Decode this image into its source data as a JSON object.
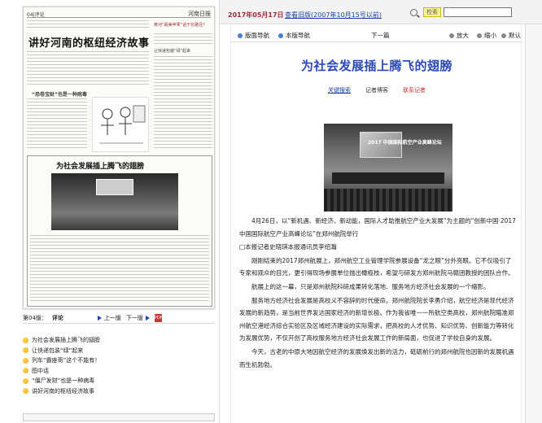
{
  "page": {
    "label": "04|评论",
    "page_label": "第04版：",
    "section": "评论",
    "prev": "上一版",
    "next": "下一版"
  },
  "paper": {
    "brand": "河南日报",
    "headline": "讲好河南的枢纽经济故事",
    "sub1": "“恐卷宝财”也是一种病毒",
    "sub2": "为社会发展插上腾飞的翅膀",
    "side1": "黄河“最美苹果”话于长路径？",
    "side2": "让快递包装“绿”起来"
  },
  "articles": [
    "为社会发展插上腾飞的翅膀",
    "让快递包装“绿”起来",
    "列车“霸座哥”这个不能有！",
    "图中话",
    "“僵尸发财”也是一种病毒",
    "讲好河南的枢纽经济故事"
  ],
  "top": {
    "date": "2017年05月17日",
    "old": "查看旧版(2007年10月15号以前)",
    "search_btn": "检索"
  },
  "toolbar": {
    "nav": "版面导航",
    "nav2": "本版导航",
    "next": "下一篇",
    "zoom_in": "放大",
    "zoom_out": "缩小",
    "default": "默认"
  },
  "article": {
    "title": "为社会发展插上腾飞的翅膀",
    "link1": "关键搜索",
    "link2": "记者博客",
    "link3": "联系记者",
    "photo_label": "2017 中国国际航空产业高峰论坛",
    "paragraphs": [
      "4月26日，以“新机遇、新经济、新动能，国际人才助推航空产业大发展”为主题的“创新中国·2017中国国际航空产业高峰论坛”在郑州航院举行",
      "□本报记者史晓琪本报通讯员李绍瀚",
      "刚刚结束的2017郑州航展上，郑州航空工业管理学院参展设备“龙之眼”分外亮眼。它不仅吸引了专家和观众的目光，更引得现场参展单位抛出橄榄枝，希望与研发方郑州航院马赣团教授的团队合作。",
      "航展上的这一幕，只是郑州航院科研成果转化落地、服务地方经济社会发展的一个缩影。",
      "服务地方经济社会发展是高校义不容辞的时代使命。郑州航院院长李勇介绍，航空经济是现代经济发展的新趋势，是当前世界发达国家经济的新增长极。作为我省唯一一所航空类高校，郑州航院瞄准郑州航空港经济综合实验区及区域经济建设的实际需求，把高校的人才优势、知识优势、创新能力等转化为发展优势，不仅开创了高校服务地方经济社会发展工作的新局面，也促进了学校自身的发展。",
      "今天，古老的中原大地因航空经济的发展焕发出新的活力，砥砺前行的郑州航院也因新的发展机遇而生机勃勃。"
    ]
  },
  "colors": {
    "title_blue": "#2a49b8",
    "date_red": "#a0283c",
    "link_blue": "#1a3fa8"
  }
}
